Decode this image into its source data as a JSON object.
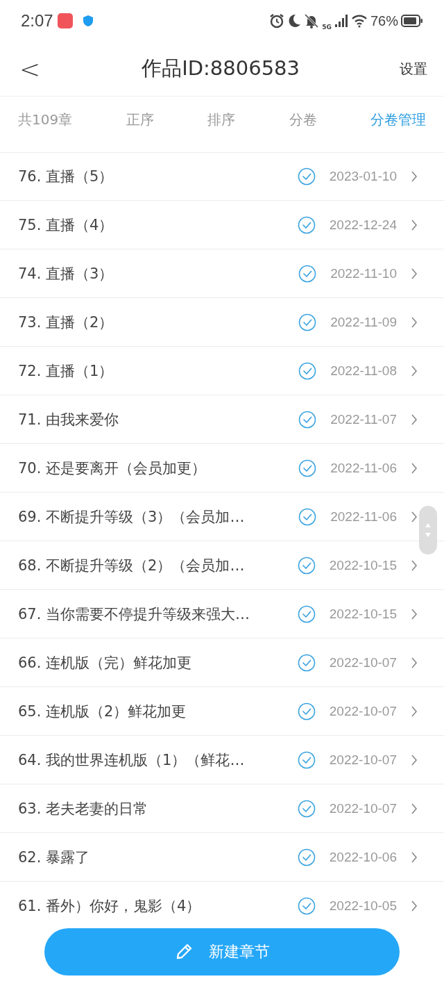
{
  "status_bar": {
    "time": "2:07",
    "battery": "76%",
    "network": "5G"
  },
  "header": {
    "back": "<",
    "title": "作品ID:8806583",
    "action": "设置"
  },
  "toolbar": {
    "count": "共109章",
    "options": [
      {
        "label": "正序",
        "selected": false
      },
      {
        "label": "排序",
        "selected": false
      },
      {
        "label": "分卷",
        "selected": false
      },
      {
        "label": "分卷管理",
        "selected": true
      }
    ]
  },
  "chapters": [
    {
      "title": "76. 直播（5）",
      "published": true,
      "date": "2023-01-10"
    },
    {
      "title": "75. 直播（4）",
      "published": true,
      "date": "2022-12-24"
    },
    {
      "title": "74. 直播（3）",
      "published": true,
      "date": "2022-11-10"
    },
    {
      "title": "73. 直播（2）",
      "published": true,
      "date": "2022-11-09"
    },
    {
      "title": "72. 直播（1）",
      "published": true,
      "date": "2022-11-08"
    },
    {
      "title": "71. 由我来爱你",
      "published": true,
      "date": "2022-11-07"
    },
    {
      "title": "70. 还是要离开（会员加更）",
      "published": true,
      "date": "2022-11-06"
    },
    {
      "title": "69. 不断提升等级（3）（会员加…",
      "published": true,
      "date": "2022-11-06"
    },
    {
      "title": "68. 不断提升等级（2）（会员加…",
      "published": true,
      "date": "2022-10-15"
    },
    {
      "title": "67. 当你需要不停提升等级来强大…",
      "published": true,
      "date": "2022-10-15"
    },
    {
      "title": "66. 连机版（完）鲜花加更",
      "published": true,
      "date": "2022-10-07"
    },
    {
      "title": "65. 连机版（2）鲜花加更",
      "published": true,
      "date": "2022-10-07"
    },
    {
      "title": "64. 我的世界连机版（1）（鲜花…",
      "published": true,
      "date": "2022-10-07"
    },
    {
      "title": "63. 老夫老妻的日常",
      "published": true,
      "date": "2022-10-07"
    },
    {
      "title": "62. 暴露了",
      "published": true,
      "date": "2022-10-06"
    },
    {
      "title": "61. 番外）你好，鬼影（4）",
      "published": true,
      "date": "2022-10-05"
    }
  ],
  "new_button": {
    "label": "新建章节"
  }
}
